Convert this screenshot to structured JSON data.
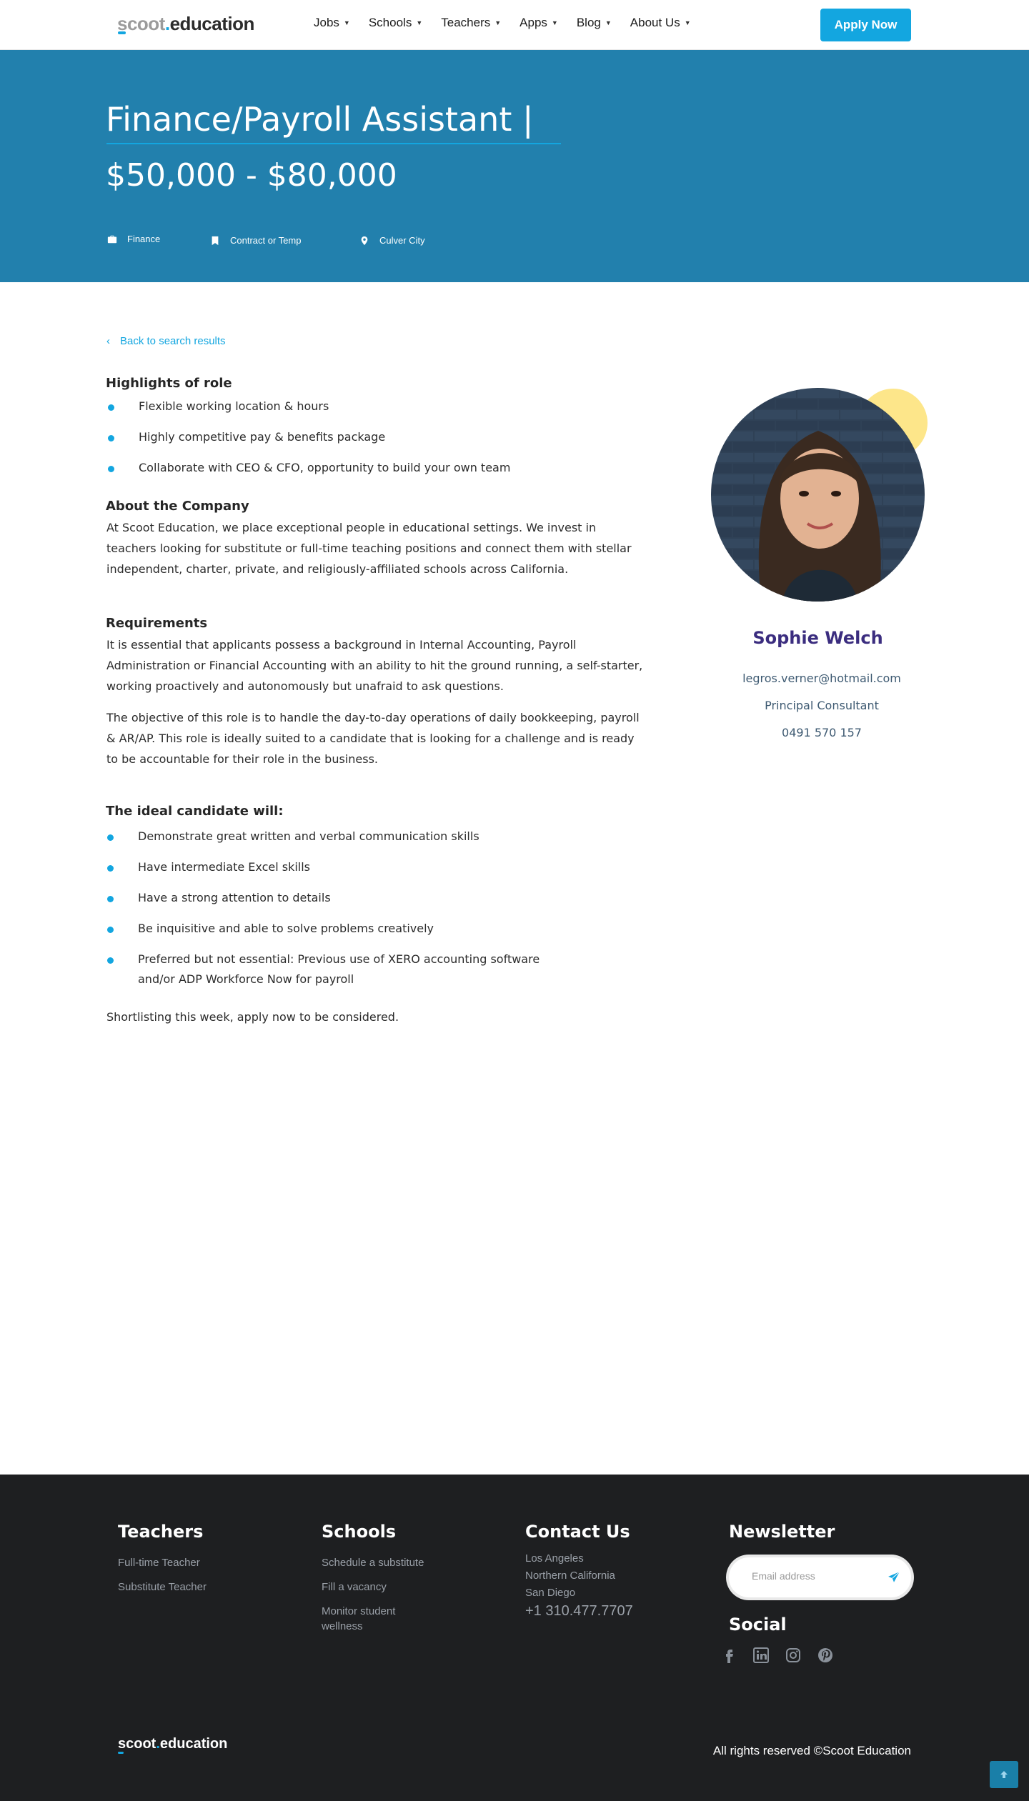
{
  "header": {
    "logo": {
      "part1": "scoot",
      "dot": ".",
      "part2": "education"
    },
    "nav": [
      {
        "label": "Jobs"
      },
      {
        "label": "Schools"
      },
      {
        "label": "Teachers"
      },
      {
        "label": "Apps"
      },
      {
        "label": "Blog"
      },
      {
        "label": "About Us"
      }
    ],
    "apply_label": "Apply Now"
  },
  "hero": {
    "title": "Finance/Payroll Assistant |",
    "salary": "$50,000 - $80,000",
    "meta": {
      "category": "Finance",
      "type": "Contract or Temp",
      "location": "Culver City"
    }
  },
  "main": {
    "back_label": "Back to search results",
    "highlights": {
      "heading": "Highlights of role",
      "items": [
        "Flexible working location & hours",
        "Highly competitive pay & benefits package",
        "Collaborate with CEO & CFO, opportunity to build your own team"
      ]
    },
    "about": {
      "heading": "About the Company",
      "text": "At Scoot Education, we place exceptional people in educational settings. We invest in teachers looking for substitute or full-time teaching positions and connect them with stellar independent, charter, private, and religiously-affiliated schools across California."
    },
    "requirements": {
      "heading": "Requirements",
      "para1": "It is essential that applicants possess a background in Internal Accounting, Payroll Administration or Financial Accounting with an ability to hit the ground running, a self-starter, working proactively and autonomously but unafraid to ask questions.",
      "para2": "The objective of this role is to handle the day-to-day operations of daily bookkeeping, payroll & AR/AP. This role is ideally suited to a candidate that is looking for a challenge and is ready to be accountable for their role in the business."
    },
    "ideal": {
      "heading": "The ideal candidate will:",
      "items": [
        "Demonstrate great written and verbal communication skills",
        "Have intermediate Excel skills",
        "Have a strong attention to details",
        "Be inquisitive and able to solve problems creatively",
        "Preferred but not essential: Previous use of XERO accounting software and/or ADP Workforce Now for payroll"
      ]
    },
    "closing": "Shortlisting this week, apply now to be considered."
  },
  "consultant": {
    "name": "Sophie Welch",
    "email": "legros.verner@hotmail.com",
    "role": "Principal Consultant",
    "phone": "0491 570 157"
  },
  "footer": {
    "teachers": {
      "heading": "Teachers",
      "links": [
        "Full-time Teacher",
        "Substitute Teacher"
      ]
    },
    "schools": {
      "heading": "Schools",
      "links": [
        "Schedule a substitute",
        "Fill a vacancy",
        "Monitor student wellness"
      ]
    },
    "contact": {
      "heading": "Contact Us",
      "locations": [
        "Los Angeles",
        "Northern California",
        "San Diego"
      ],
      "phone": "+1 310.477.7707"
    },
    "newsletter": {
      "heading": "Newsletter",
      "placeholder": "Email address"
    },
    "social": {
      "heading": "Social",
      "icons": [
        "facebook-icon",
        "linkedin-icon",
        "instagram-icon",
        "pinterest-icon"
      ]
    },
    "logo": {
      "part1": "scoot",
      "dot": ".",
      "part2": "education"
    },
    "rights": "All rights reserved ©Scoot Education"
  },
  "colors": {
    "accent": "#13a6e0",
    "hero": "#2280ad",
    "footer": "#1e1f21",
    "name": "#3b2d7f",
    "highlight_circle": "#fde68a"
  }
}
